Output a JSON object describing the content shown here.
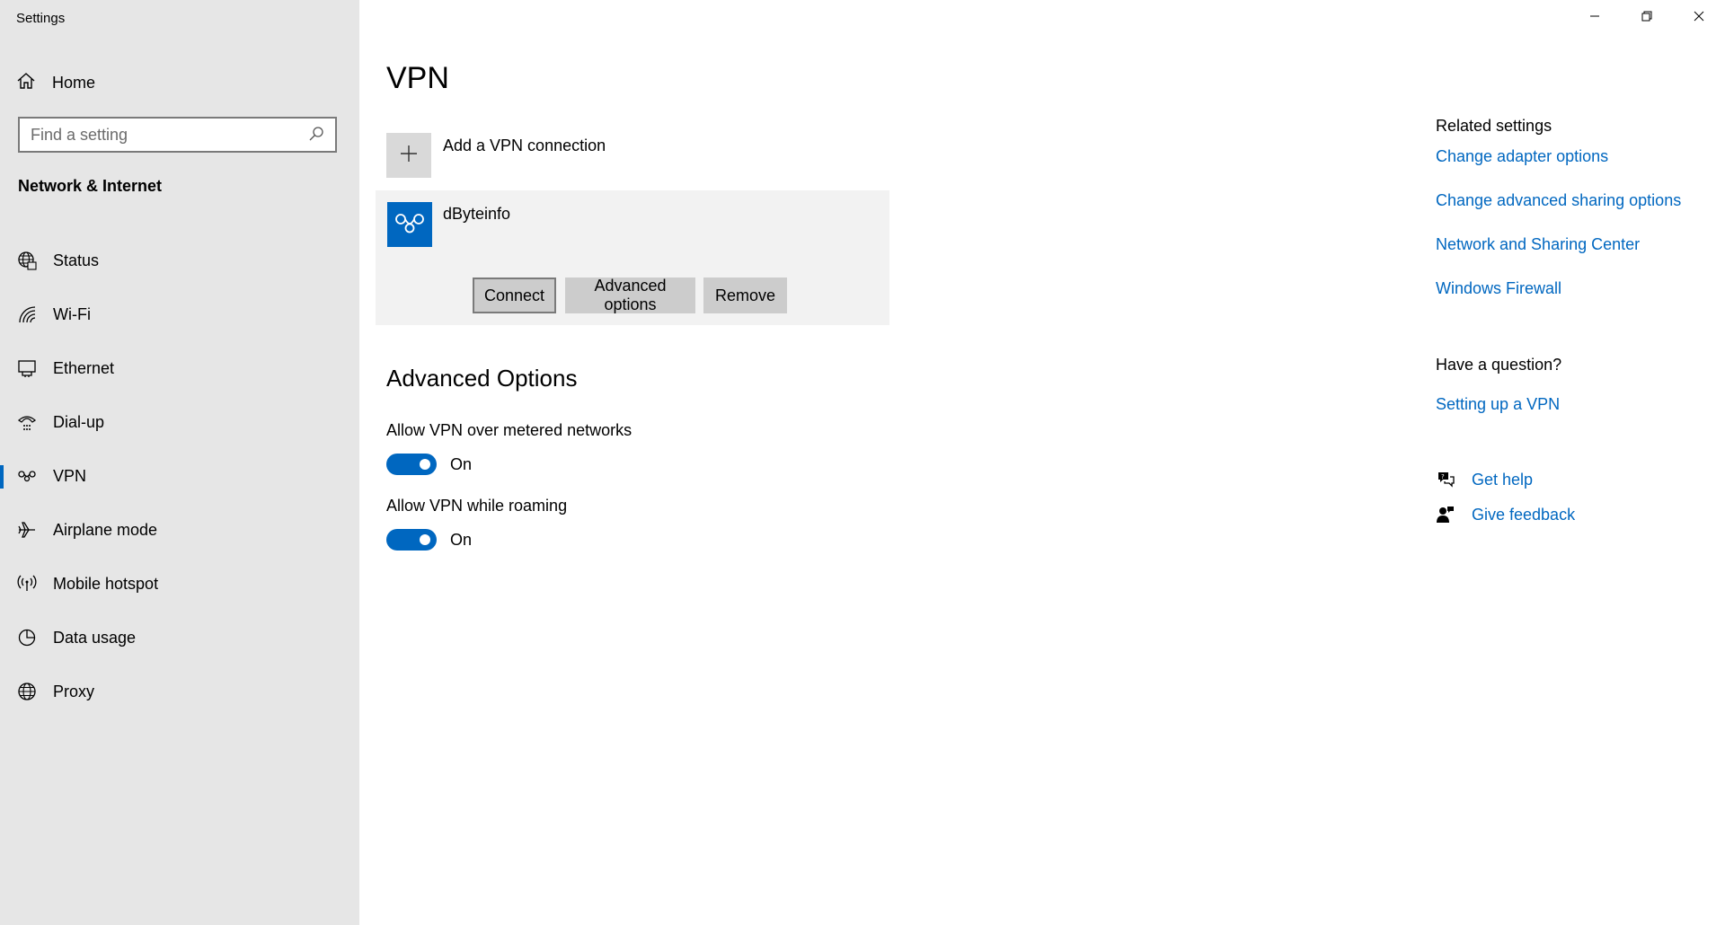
{
  "app": {
    "title": "Settings"
  },
  "sidebar": {
    "home_label": "Home",
    "search_placeholder": "Find a setting",
    "section_title": "Network & Internet",
    "items": [
      {
        "label": "Status",
        "icon": "globe-status-icon"
      },
      {
        "label": "Wi-Fi",
        "icon": "wifi-icon"
      },
      {
        "label": "Ethernet",
        "icon": "ethernet-icon"
      },
      {
        "label": "Dial-up",
        "icon": "dialup-icon"
      },
      {
        "label": "VPN",
        "icon": "vpn-icon",
        "selected": true
      },
      {
        "label": "Airplane mode",
        "icon": "airplane-icon"
      },
      {
        "label": "Mobile hotspot",
        "icon": "hotspot-icon"
      },
      {
        "label": "Data usage",
        "icon": "data-usage-icon"
      },
      {
        "label": "Proxy",
        "icon": "globe-icon"
      }
    ]
  },
  "main": {
    "title": "VPN",
    "add_label": "Add a VPN connection",
    "connection": {
      "name": "dByteinfo",
      "connect_label": "Connect",
      "advanced_label": "Advanced options",
      "remove_label": "Remove"
    },
    "advanced_title": "Advanced Options",
    "options": [
      {
        "label": "Allow VPN over metered networks",
        "state": "On"
      },
      {
        "label": "Allow VPN while roaming",
        "state": "On"
      }
    ]
  },
  "related": {
    "title": "Related settings",
    "links": [
      "Change adapter options",
      "Change advanced sharing options",
      "Network and Sharing Center",
      "Windows Firewall"
    ],
    "question_title": "Have a question?",
    "question_link": "Setting up a VPN",
    "get_help": "Get help",
    "give_feedback": "Give feedback"
  },
  "colors": {
    "accent": "#0067c0",
    "sidebar_bg": "#e6e6e6",
    "card_bg": "#f2f2f2",
    "button_bg": "#cccccc"
  }
}
